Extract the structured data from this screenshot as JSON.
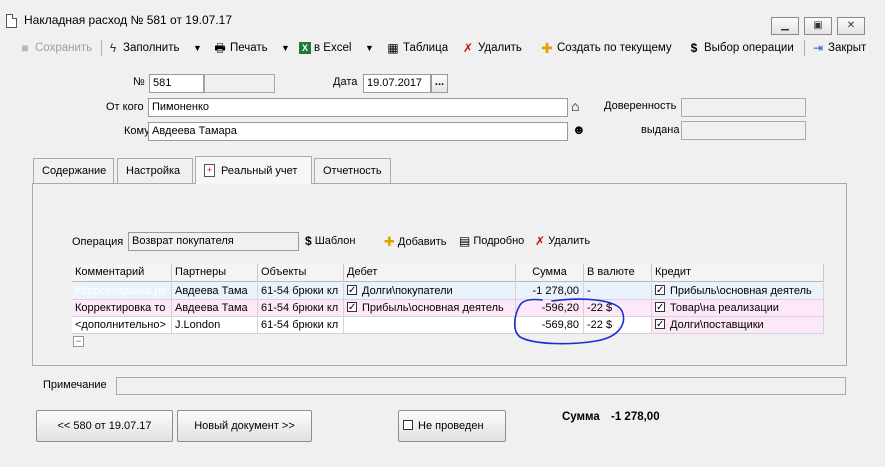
{
  "window": {
    "title": "Накладная расход № 581 от 19.07.17",
    "controls": [
      "minimize",
      "maximize",
      "close"
    ]
  },
  "toolbar": {
    "save": "Сохранить",
    "fill": "Заполнить",
    "print": "Печать",
    "excel": "в Excel",
    "table": "Таблица",
    "delete": "Удалить",
    "create_from": "Создать по текущему",
    "choose_op": "Выбор операции",
    "close": "Закрыт"
  },
  "header": {
    "number_label": "№",
    "number": "581",
    "date_label": "Дата",
    "date": "19.07.2017",
    "dots": "...",
    "from_label": "От кого",
    "from": "Пимоненко",
    "to_label": "Кому",
    "to": "Авдеева Тамара",
    "proxy_label": "Доверенность",
    "issued_label": "выдана"
  },
  "tabs": [
    {
      "label": "Содержание"
    },
    {
      "label": "Настройка"
    },
    {
      "label": "Реальный учет"
    },
    {
      "label": "Отчетность"
    }
  ],
  "panel": {
    "operation_label": "Операция",
    "operation": "Возврат покупателя",
    "template": "Шаблон",
    "add": "Добавить",
    "details": "Подробно",
    "delete": "Удалить"
  },
  "grid": {
    "columns": [
      "Комментарий",
      "Партнеры",
      "Объекты",
      "Дебет",
      "Сумма",
      "В валюте",
      "Кредит"
    ],
    "rows": [
      {
        "comment": "Корректировка ре",
        "partner": "Авдеева Тама",
        "object": "61-54 брюки кл",
        "debit": "Долги\\покупатели",
        "sum": "-1 278,00",
        "currency": "-",
        "credit": "Прибыль\\основная деятель"
      },
      {
        "comment": "Корректировка то",
        "partner": "Авдеева Тама",
        "object": "61-54 брюки кл",
        "debit": "Прибыль\\основная деятель",
        "sum": "-596,20",
        "currency": "-22 $",
        "credit": "Товар\\на реализации"
      },
      {
        "comment": "<дополнительно>",
        "partner": "J.London",
        "object": "61-54 брюки кл",
        "debit": "",
        "sum": "-569,80",
        "currency": "-22 $",
        "credit": "Долги\\поставщики"
      }
    ],
    "collapse": "−"
  },
  "footer": {
    "note_label": "Примечание",
    "note": "",
    "prev_button": "<< 580 от 19.07.17",
    "next_button": "Новый документ >>",
    "status_checkbox": "Не проведен",
    "sum_label": "Сумма",
    "sum_value": "-1 278,00"
  },
  "colors": {
    "selection": "#3b6fb4",
    "row_pink": "#fce8f8",
    "row_blue": "#eaf2fd",
    "annotation_ink": "#1a2fd0",
    "delete_red": "#c01010"
  }
}
